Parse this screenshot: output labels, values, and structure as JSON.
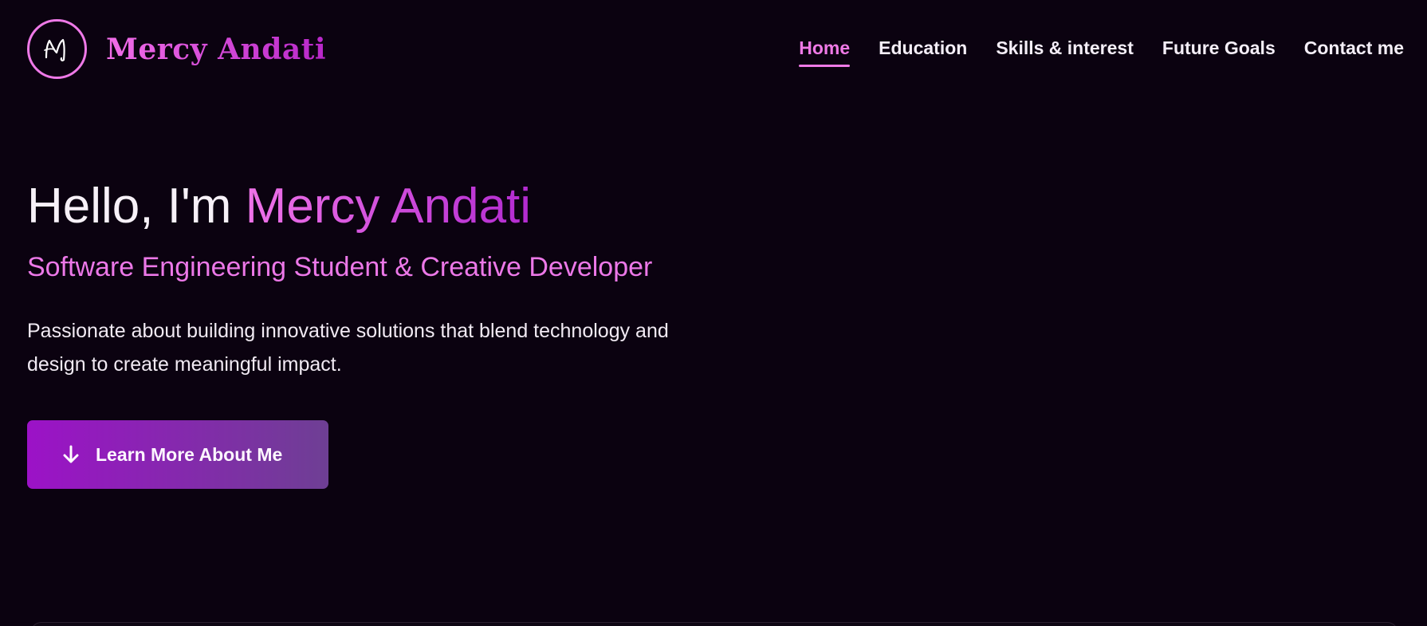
{
  "header": {
    "logo_icon": "monogram-m-icon",
    "brand_name": "Mercy Andati",
    "nav": [
      {
        "label": "Home",
        "active": true
      },
      {
        "label": "Education",
        "active": false
      },
      {
        "label": "Skills & interest",
        "active": false
      },
      {
        "label": "Future Goals",
        "active": false
      },
      {
        "label": "Contact me",
        "active": false
      }
    ]
  },
  "hero": {
    "greeting": "Hello, I'm ",
    "name": "Mercy Andati",
    "subtitle": "Software Engineering Student & Creative Developer",
    "description": "Passionate about building innovative solutions that blend technology and design to create meaningful impact.",
    "cta": {
      "label": "Learn More About Me",
      "icon": "arrow-down-icon"
    }
  },
  "colors": {
    "background": "#0b0210",
    "accent_pink": "#ef7ae6",
    "accent_purple": "#b22ad0",
    "button_gradient_start": "#9c12c7",
    "button_gradient_end": "#6e3f94",
    "text": "#f3ecf5"
  }
}
